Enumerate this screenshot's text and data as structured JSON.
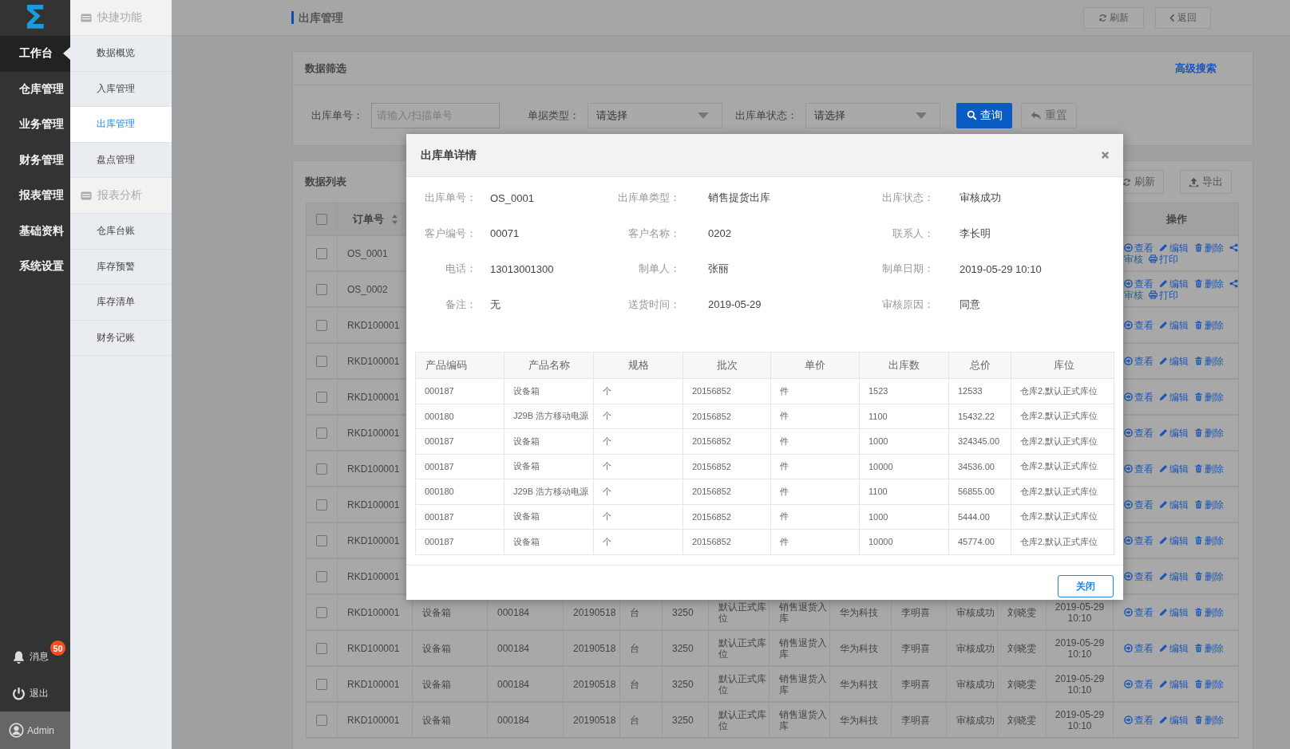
{
  "logo": "Σ",
  "nav": {
    "items": [
      {
        "label": "工作台",
        "selected": true
      },
      {
        "label": "仓库管理",
        "selected": false
      },
      {
        "label": "业务管理",
        "selected": false
      },
      {
        "label": "财务管理",
        "selected": false
      },
      {
        "label": "报表管理",
        "selected": false
      },
      {
        "label": "基础资料",
        "selected": false
      },
      {
        "label": "系统设置",
        "selected": false
      }
    ],
    "messages": {
      "label": "消息",
      "badge": "50"
    },
    "logout": "退出",
    "user": "Admin"
  },
  "submenu": {
    "groups": [
      {
        "title": "快捷功能",
        "items": [
          {
            "label": "数据概览",
            "selected": false
          },
          {
            "label": "入库管理",
            "selected": false
          },
          {
            "label": "出库管理",
            "selected": true
          },
          {
            "label": "盘点管理",
            "selected": false
          }
        ]
      },
      {
        "title": "报表分析",
        "items": [
          {
            "label": "仓库台账",
            "selected": false
          },
          {
            "label": "库存预警",
            "selected": false
          },
          {
            "label": "库存清单",
            "selected": false
          },
          {
            "label": "财务记账",
            "selected": false
          }
        ]
      }
    ]
  },
  "page": {
    "title": "出库管理",
    "buttons": [
      {
        "kind": "refresh",
        "label": "刷新"
      },
      {
        "kind": "back",
        "label": "返回"
      }
    ]
  },
  "filter": {
    "title": "数据筛选",
    "advanced_link": "高级搜索",
    "fields": [
      {
        "kind": "input",
        "label": "出库单号：",
        "placeholder": "请输入/扫描单号"
      },
      {
        "kind": "select",
        "label": "单据类型：",
        "value": "请选择"
      },
      {
        "kind": "select",
        "label": "出库单状态：",
        "value": "请选择"
      }
    ],
    "buttons": [
      {
        "kind": "search",
        "label": "查询"
      },
      {
        "kind": "reset",
        "label": "重置"
      }
    ]
  },
  "list": {
    "title": "数据列表",
    "buttons": [
      {
        "kind": "refresh",
        "label": "刷新"
      },
      {
        "kind": "export",
        "label": "导出"
      }
    ],
    "table": {
      "header": {
        "checked": false,
        "order_column": "订单号",
        "actions_column": "操作"
      },
      "rows": [
        {
          "checked": false,
          "order_no": "OS_0001",
          "actions": [
            {
              "kind": "view",
              "label": "查看"
            },
            {
              "kind": "edit",
              "label": "编辑"
            },
            {
              "kind": "delete",
              "label": "删除"
            },
            {
              "kind": "share"
            },
            {
              "kind": "audit",
              "label": "审核"
            },
            {
              "kind": "print",
              "label": "打印"
            }
          ]
        },
        {
          "checked": false,
          "order_no": "OS_0002",
          "actions": [
            {
              "kind": "view",
              "label": "查看"
            },
            {
              "kind": "edit",
              "label": "编辑"
            },
            {
              "kind": "delete",
              "label": "删除"
            },
            {
              "kind": "share"
            },
            {
              "kind": "audit",
              "label": "审核"
            },
            {
              "kind": "print",
              "label": "打印"
            }
          ]
        },
        {
          "checked": false,
          "order_no": "RKD100001",
          "actions": [
            {
              "kind": "view",
              "label": "查看"
            },
            {
              "kind": "edit",
              "label": "编辑"
            },
            {
              "kind": "delete",
              "label": "删除"
            }
          ]
        },
        {
          "checked": false,
          "order_no": "RKD100001",
          "actions": [
            {
              "kind": "view",
              "label": "查看"
            },
            {
              "kind": "edit",
              "label": "编辑"
            },
            {
              "kind": "delete",
              "label": "删除"
            }
          ]
        },
        {
          "checked": false,
          "order_no": "RKD100001",
          "actions": [
            {
              "kind": "view",
              "label": "查看"
            },
            {
              "kind": "edit",
              "label": "编辑"
            },
            {
              "kind": "delete",
              "label": "删除"
            }
          ]
        },
        {
          "checked": false,
          "order_no": "RKD100001",
          "actions": [
            {
              "kind": "view",
              "label": "查看"
            },
            {
              "kind": "edit",
              "label": "编辑"
            },
            {
              "kind": "delete",
              "label": "删除"
            }
          ]
        },
        {
          "checked": false,
          "order_no": "RKD100001",
          "actions": [
            {
              "kind": "view",
              "label": "查看"
            },
            {
              "kind": "edit",
              "label": "编辑"
            },
            {
              "kind": "delete",
              "label": "删除"
            }
          ]
        },
        {
          "checked": false,
          "order_no": "RKD100001",
          "actions": [
            {
              "kind": "view",
              "label": "查看"
            },
            {
              "kind": "edit",
              "label": "编辑"
            },
            {
              "kind": "delete",
              "label": "删除"
            }
          ]
        },
        {
          "checked": false,
          "order_no": "RKD100001",
          "actions": [
            {
              "kind": "view",
              "label": "查看"
            },
            {
              "kind": "edit",
              "label": "编辑"
            },
            {
              "kind": "delete",
              "label": "删除"
            }
          ]
        },
        {
          "checked": false,
          "order_no": "RKD100001",
          "actions": [
            {
              "kind": "view",
              "label": "查看"
            },
            {
              "kind": "edit",
              "label": "编辑"
            },
            {
              "kind": "delete",
              "label": "删除"
            }
          ]
        },
        {
          "checked": false,
          "order_no": "RKD100001",
          "cells": [
            "设备箱",
            "000184",
            "20190518",
            "台",
            "3250",
            "默认正式库位",
            "销售退货入库",
            "华为科技",
            "李明喜",
            "审核成功",
            "刘晓雯",
            "2019-05-29 10:10"
          ],
          "actions": [
            {
              "kind": "view",
              "label": "查看"
            },
            {
              "kind": "edit",
              "label": "编辑"
            },
            {
              "kind": "delete",
              "label": "删除"
            }
          ]
        },
        {
          "checked": false,
          "order_no": "RKD100001",
          "cells": [
            "设备箱",
            "000184",
            "20190518",
            "台",
            "3250",
            "默认正式库位",
            "销售退货入库",
            "华为科技",
            "李明喜",
            "审核成功",
            "刘晓雯",
            "2019-05-29 10:10"
          ],
          "actions": [
            {
              "kind": "view",
              "label": "查看"
            },
            {
              "kind": "edit",
              "label": "编辑"
            },
            {
              "kind": "delete",
              "label": "删除"
            }
          ]
        },
        {
          "checked": false,
          "order_no": "RKD100001",
          "cells": [
            "设备箱",
            "000184",
            "20190518",
            "台",
            "3250",
            "默认正式库位",
            "销售退货入库",
            "华为科技",
            "李明喜",
            "审核成功",
            "刘晓雯",
            "2019-05-29 10:10"
          ],
          "actions": [
            {
              "kind": "view",
              "label": "查看"
            },
            {
              "kind": "edit",
              "label": "编辑"
            },
            {
              "kind": "delete",
              "label": "删除"
            }
          ]
        },
        {
          "checked": false,
          "order_no": "RKD100001",
          "cells": [
            "设备箱",
            "000184",
            "20190518",
            "台",
            "3250",
            "默认正式库位",
            "销售退货入库",
            "华为科技",
            "李明喜",
            "审核成功",
            "刘晓雯",
            "2019-05-29 10:10"
          ],
          "actions": [
            {
              "kind": "view",
              "label": "查看"
            },
            {
              "kind": "edit",
              "label": "编辑"
            },
            {
              "kind": "delete",
              "label": "删除"
            }
          ]
        }
      ]
    }
  },
  "modal": {
    "title": "出库单详情",
    "fields": [
      {
        "label": "出库单号：",
        "value": "OS_0001"
      },
      {
        "label": "出库单类型：",
        "value": "销售提货出库"
      },
      {
        "label": "出库状态：",
        "value": "审核成功"
      },
      {
        "label": "客户编号：",
        "value": "00071"
      },
      {
        "label": "客户名称：",
        "value": "0202"
      },
      {
        "label": "联系人：",
        "value": "李长明"
      },
      {
        "label": "电话：",
        "value": "13013001300"
      },
      {
        "label": "制单人：",
        "value": "张丽"
      },
      {
        "label": "制单日期：",
        "value": "2019-05-29 10:10"
      },
      {
        "label": "备注：",
        "value": "无"
      },
      {
        "label": "送货时间：",
        "value": "2019-05-29"
      },
      {
        "label": "审核原因：",
        "value": "同意"
      }
    ],
    "table": {
      "columns": [
        "产品编码",
        "产品名称",
        "规格",
        "批次",
        "单价",
        "出库数",
        "总价",
        "库位"
      ],
      "rows": [
        [
          "000187",
          "设备箱",
          "个",
          "20156852",
          "件",
          "1523",
          "12533",
          "仓库2.默认正式库位"
        ],
        [
          "000180",
          "J29B 浩方移动电源",
          "个",
          "20156852",
          "件",
          "1100",
          "15432.22",
          "仓库2.默认正式库位"
        ],
        [
          "000187",
          "设备箱",
          "个",
          "20156852",
          "件",
          "1000",
          "324345.00",
          "仓库2.默认正式库位"
        ],
        [
          "000187",
          "设备箱",
          "个",
          "20156852",
          "件",
          "10000",
          "34536.00",
          "仓库2.默认正式库位"
        ],
        [
          "000180",
          "J29B 浩方移动电源",
          "个",
          "20156852",
          "件",
          "1100",
          "56855.00",
          "仓库2.默认正式库位"
        ],
        [
          "000187",
          "设备箱",
          "个",
          "20156852",
          "件",
          "1000",
          "5444.00",
          "仓库2.默认正式库位"
        ],
        [
          "000187",
          "设备箱",
          "个",
          "20156852",
          "件",
          "10000",
          "45774.00",
          "仓库2.默认正式库位"
        ]
      ]
    },
    "close_button": "关闭"
  }
}
